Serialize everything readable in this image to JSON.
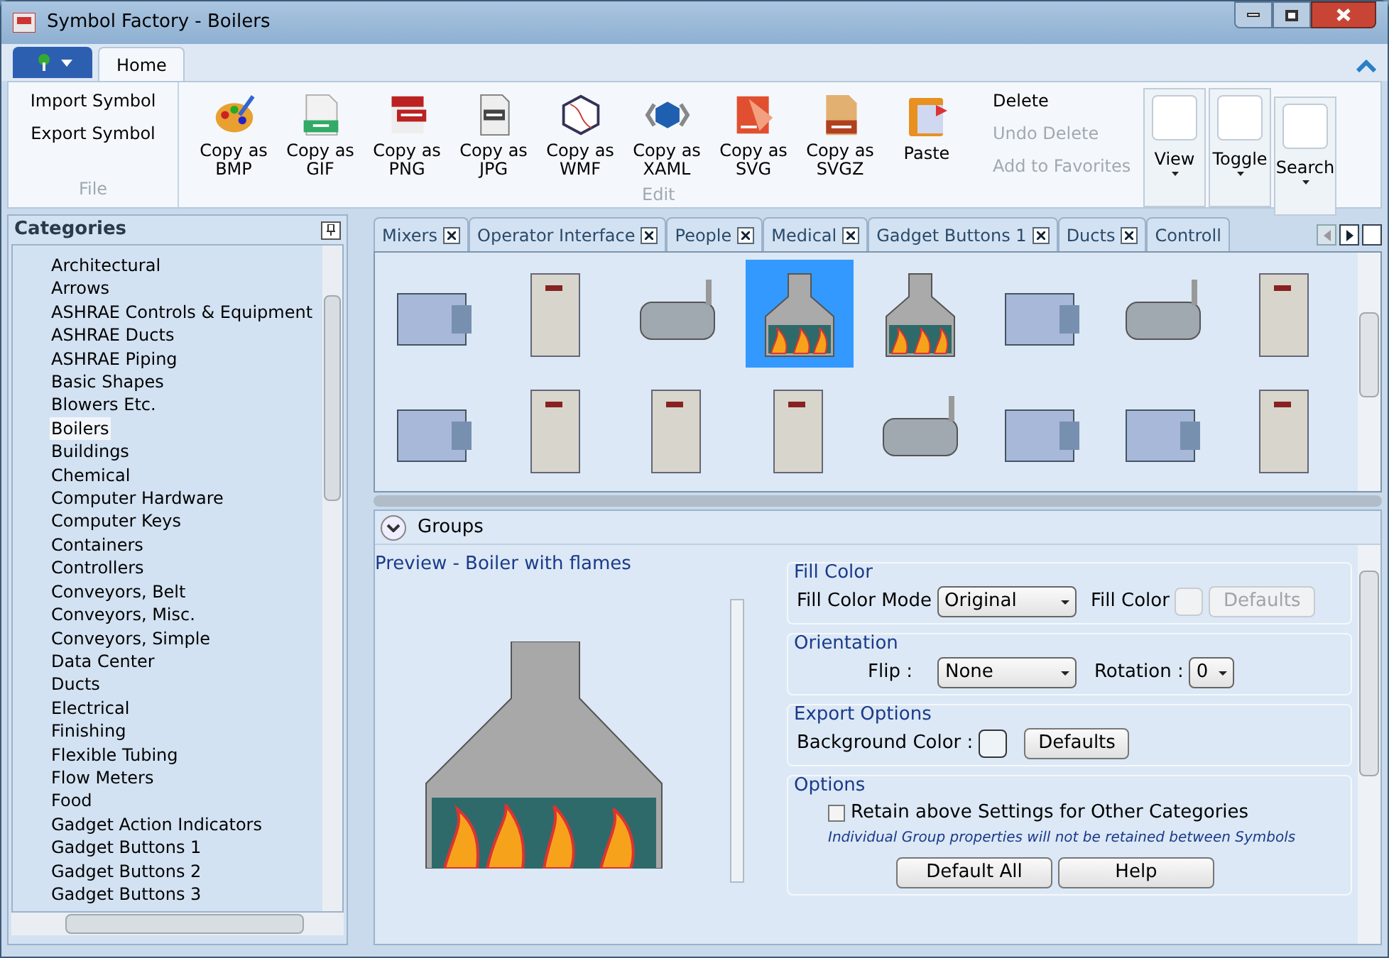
{
  "window": {
    "title": "Symbol Factory - Boilers"
  },
  "ribbon": {
    "tabs": [
      {
        "label": "Home",
        "selected": true
      }
    ],
    "file_group": {
      "items": [
        {
          "label": "Import Symbol",
          "disabled": false
        },
        {
          "label": "Export Symbol",
          "disabled": false
        }
      ],
      "caption": "File"
    },
    "edit_group": {
      "buttons": [
        {
          "kind": "bmp",
          "label": "Copy as BMP"
        },
        {
          "kind": "gif",
          "label": "Copy as GIF"
        },
        {
          "kind": "png",
          "label": "Copy as PNG"
        },
        {
          "kind": "jpg",
          "label": "Copy as JPG"
        },
        {
          "kind": "wmf",
          "label": "Copy as WMF"
        },
        {
          "kind": "xaml",
          "label": "Copy as XAML"
        },
        {
          "kind": "svg",
          "label": "Copy as SVG"
        },
        {
          "kind": "svgz",
          "label": "Copy as SVGZ"
        },
        {
          "kind": "paste",
          "label": "Paste"
        }
      ],
      "items": [
        {
          "label": "Delete",
          "disabled": false
        },
        {
          "label": "Undo Delete",
          "disabled": true
        },
        {
          "label": "Add to Favorites",
          "disabled": true
        }
      ],
      "caption": "Edit"
    },
    "menus": [
      {
        "label": "View"
      },
      {
        "label": "Toggle"
      },
      {
        "label": "Search"
      }
    ]
  },
  "categories": {
    "title": "Categories",
    "items": [
      {
        "label": "Architectural",
        "selected": false
      },
      {
        "label": "Arrows",
        "selected": false
      },
      {
        "label": "ASHRAE Controls & Equipment",
        "selected": false
      },
      {
        "label": "ASHRAE Ducts",
        "selected": false
      },
      {
        "label": "ASHRAE Piping",
        "selected": false
      },
      {
        "label": "Basic Shapes",
        "selected": false
      },
      {
        "label": "Blowers Etc.",
        "selected": false
      },
      {
        "label": "Boilers",
        "selected": true
      },
      {
        "label": "Buildings",
        "selected": false
      },
      {
        "label": "Chemical",
        "selected": false
      },
      {
        "label": "Computer Hardware",
        "selected": false
      },
      {
        "label": "Computer Keys",
        "selected": false
      },
      {
        "label": "Containers",
        "selected": false
      },
      {
        "label": "Controllers",
        "selected": false
      },
      {
        "label": "Conveyors, Belt",
        "selected": false
      },
      {
        "label": "Conveyors, Misc.",
        "selected": false
      },
      {
        "label": "Conveyors, Simple",
        "selected": false
      },
      {
        "label": "Data Center",
        "selected": false
      },
      {
        "label": "Ducts",
        "selected": false
      },
      {
        "label": "Electrical",
        "selected": false
      },
      {
        "label": "Finishing",
        "selected": false
      },
      {
        "label": "Flexible Tubing",
        "selected": false
      },
      {
        "label": "Flow Meters",
        "selected": false
      },
      {
        "label": "Food",
        "selected": false
      },
      {
        "label": "Gadget Action Indicators",
        "selected": false
      },
      {
        "label": "Gadget Buttons 1",
        "selected": false
      },
      {
        "label": "Gadget Buttons 2",
        "selected": false
      },
      {
        "label": "Gadget Buttons 3",
        "selected": false
      }
    ]
  },
  "doc_tabs": [
    {
      "label": "Mixers",
      "selected": false
    },
    {
      "label": "Operator Interface",
      "selected": false
    },
    {
      "label": "People",
      "selected": false
    },
    {
      "label": "Medical",
      "selected": false
    },
    {
      "label": "Gadget Buttons 1",
      "selected": false
    },
    {
      "label": "Ducts",
      "selected": false
    },
    {
      "label": "Controll",
      "selected": false
    }
  ],
  "symbols": [
    {
      "kind": "box",
      "selected": false
    },
    {
      "kind": "cabinet",
      "selected": false
    },
    {
      "kind": "tank",
      "selected": false
    },
    {
      "kind": "flame",
      "selected": true
    },
    {
      "kind": "flame",
      "selected": false
    },
    {
      "kind": "box",
      "selected": false
    },
    {
      "kind": "tank",
      "selected": false
    },
    {
      "kind": "cabinet",
      "selected": false
    },
    {
      "kind": "box",
      "selected": false
    },
    {
      "kind": "cabinet",
      "selected": false
    },
    {
      "kind": "cabinet",
      "selected": false
    },
    {
      "kind": "cabinet",
      "selected": false
    },
    {
      "kind": "tank",
      "selected": false
    },
    {
      "kind": "box",
      "selected": false
    },
    {
      "kind": "box",
      "selected": false
    },
    {
      "kind": "cabinet",
      "selected": false
    }
  ],
  "groups": {
    "label": "Groups",
    "expanded": false
  },
  "preview": {
    "title": "Preview - Boiler with flames"
  },
  "fill_color": {
    "legend": "Fill Color",
    "mode_label": "Fill Color Mode",
    "mode": "Original",
    "color_label": "Fill Color",
    "defaults": "Defaults"
  },
  "orientation": {
    "legend": "Orientation",
    "flip_label": "Flip :",
    "flip": "None",
    "rotation_label": "Rotation :",
    "rotation": "0"
  },
  "export_options": {
    "legend": "Export Options",
    "bg_label": "Background Color :",
    "defaults": "Defaults"
  },
  "options": {
    "legend": "Options",
    "retain_label": "Retain above Settings for Other Categories",
    "retain_checked": false,
    "note": "Individual Group properties will not be retained between Symbols",
    "buttons": [
      "Default All",
      "Help"
    ]
  }
}
